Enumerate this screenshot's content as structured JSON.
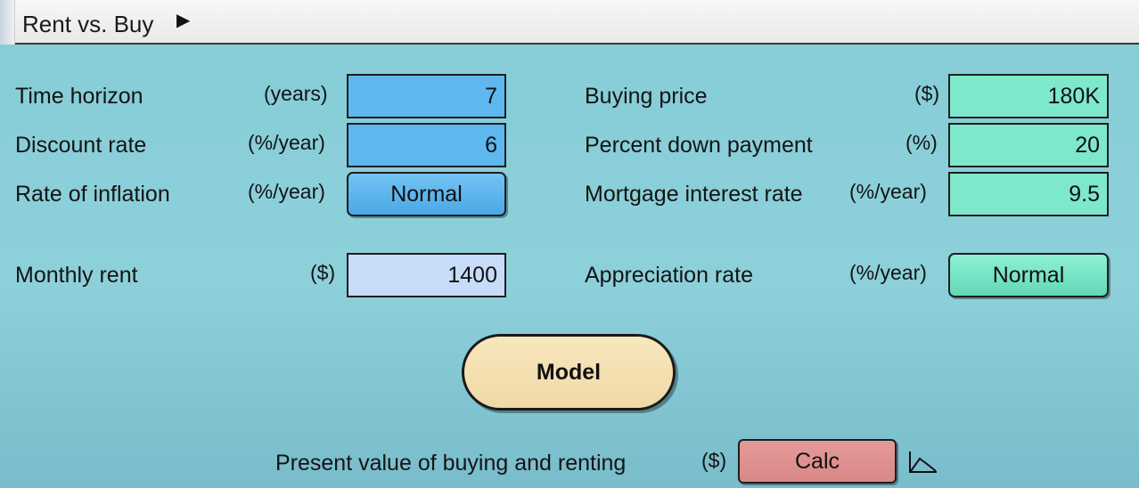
{
  "window": {
    "title": "Rent vs. Buy",
    "arrow": "▶"
  },
  "left": {
    "time_horizon": {
      "label": "Time horizon",
      "unit": "(years)",
      "value": "7"
    },
    "discount_rate": {
      "label": "Discount rate",
      "unit": "(%/year)",
      "value": "6"
    },
    "inflation": {
      "label": "Rate of inflation",
      "unit": "(%/year)",
      "value": "Normal"
    },
    "monthly_rent": {
      "label": "Monthly rent",
      "unit": "($)",
      "value": "1400"
    }
  },
  "right": {
    "buying_price": {
      "label": "Buying price",
      "unit": "($)",
      "value": "180K"
    },
    "down_payment": {
      "label": "Percent down payment",
      "unit": "(%)",
      "value": "20"
    },
    "mortgage_rate": {
      "label": "Mortgage interest rate",
      "unit": "(%/year)",
      "value": "9.5"
    },
    "appreciation": {
      "label": "Appreciation rate",
      "unit": "(%/year)",
      "value": "Normal"
    }
  },
  "model_button": "Model",
  "result": {
    "label": "Present value of buying and renting",
    "unit": "($)",
    "button": "Calc",
    "graph_icon": "graph-icon"
  },
  "colors": {
    "panel": "#86cdd8",
    "blue_field": "#5eb7ee",
    "green_field": "#7ee8cc",
    "rent_field": "#c6dcf9",
    "model_button": "#f3dfb1",
    "calc_button": "#df9090"
  }
}
